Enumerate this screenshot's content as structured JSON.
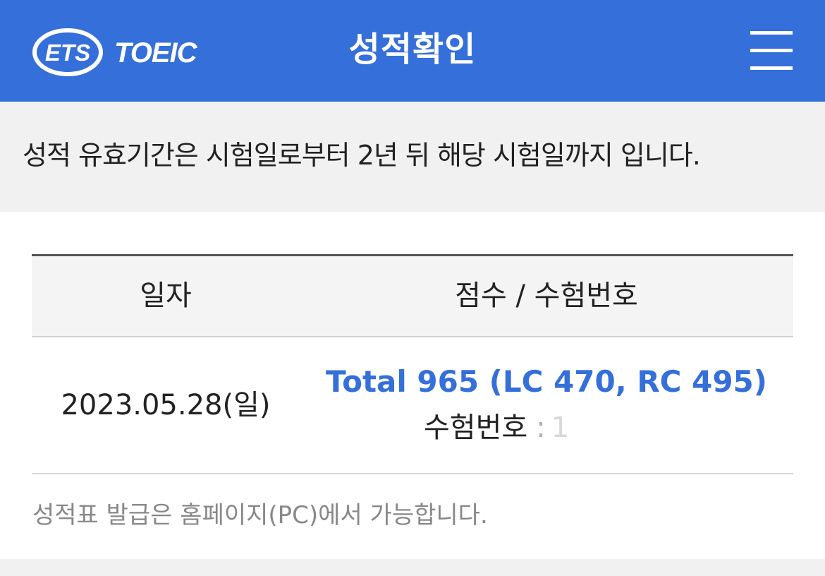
{
  "header": {
    "logo_text": "ETS TOEIC",
    "title": "성적확인",
    "menu_icon": "hamburger-menu-icon"
  },
  "notice": {
    "text": "성적 유효기간은 시험일로부터 2년 뒤 해당 시험일까지 입니다."
  },
  "table": {
    "headers": [
      "일자",
      "점수 / 수험번호"
    ],
    "rows": [
      {
        "date": "2023.05.28(일)",
        "total": "Total 965 (LC 470, RC 495)",
        "exam_label": "수험번호",
        "exam_separator": ":",
        "exam_value": "1"
      }
    ]
  },
  "footnote": "성적표 발급은 홈페이지(PC)에서 가능합니다.",
  "colors": {
    "header_bg": "#356fd9",
    "score_text": "#356fd9",
    "band_bg": "#f1f1f1"
  }
}
